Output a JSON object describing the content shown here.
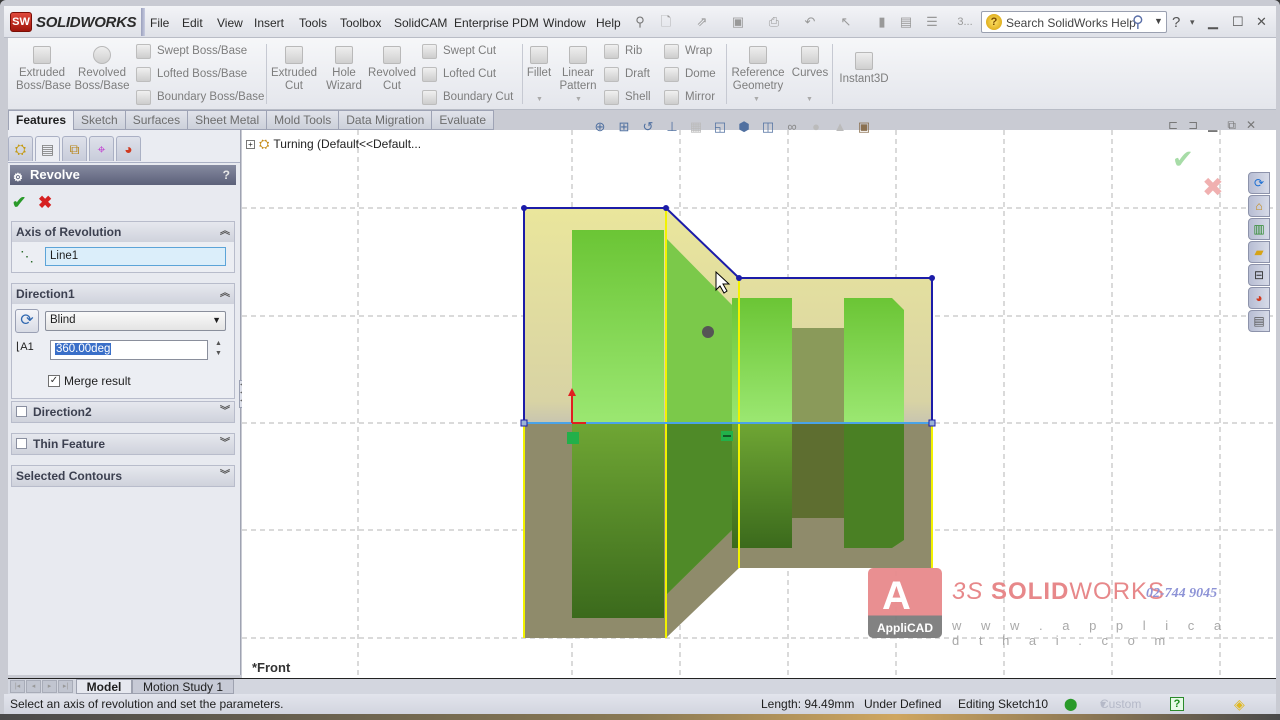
{
  "app": {
    "logo_text": "SOLIDWORKS",
    "logo_badge": "SW"
  },
  "menu": [
    "File",
    "Edit",
    "View",
    "Insert",
    "Tools",
    "Toolbox",
    "SolidCAM",
    "Enterprise PDM",
    "Window",
    "Help"
  ],
  "quick_access_overflow": "3...",
  "search": {
    "placeholder": "Search SolidWorks Help"
  },
  "commandmanager": {
    "large_buttons": [
      {
        "label": "Extruded\nBoss/Base",
        "line1": "Extruded",
        "line2": "Boss/Base"
      },
      {
        "label": "Revolved Boss/Base",
        "line1": "Revolved",
        "line2": "Boss/Base"
      },
      {
        "label": "Extruded Cut",
        "line1": "Extruded",
        "line2": "Cut"
      },
      {
        "label": "Hole Wizard",
        "line1": "Hole",
        "line2": "Wizard"
      },
      {
        "label": "Revolved Cut",
        "line1": "Revolved",
        "line2": "Cut"
      },
      {
        "label": "Fillet",
        "line1": "Fillet",
        "line2": ""
      },
      {
        "label": "Linear Pattern",
        "line1": "Linear",
        "line2": "Pattern"
      },
      {
        "label": "Reference Geometry",
        "line1": "Reference",
        "line2": "Geometry"
      },
      {
        "label": "Curves",
        "line1": "Curves",
        "line2": ""
      },
      {
        "label": "Instant3D",
        "line1": "Instant3D",
        "line2": ""
      }
    ],
    "small_buttons": [
      "Swept Boss/Base",
      "Lofted Boss/Base",
      "Boundary Boss/Base",
      "Swept Cut",
      "Lofted Cut",
      "Boundary Cut",
      "Rib",
      "Draft",
      "Shell",
      "Wrap",
      "Dome",
      "Mirror"
    ]
  },
  "tabs": [
    {
      "label": "Features",
      "active": true
    },
    {
      "label": "Sketch"
    },
    {
      "label": "Surfaces"
    },
    {
      "label": "Sheet Metal"
    },
    {
      "label": "Mold Tools"
    },
    {
      "label": "Data Migration"
    },
    {
      "label": "Evaluate"
    }
  ],
  "panel_tabs": [
    "feature-manager-icon",
    "property-manager-icon",
    "configuration-manager-icon",
    "dimxpert-icon",
    "display-manager-icon"
  ],
  "property_manager": {
    "title": "Revolve",
    "help": "?",
    "ok": "✔",
    "cancel": "✖",
    "axis_group": {
      "title": "Axis of Revolution",
      "value": "Line1"
    },
    "direction1": {
      "title": "Direction1",
      "end_condition": "Blind",
      "angle": "360.00deg",
      "merge_result_label": "Merge result",
      "merge_result_checked": true
    },
    "direction2": {
      "title": "Direction2",
      "checked": false
    },
    "thin_feature": {
      "title": "Thin Feature",
      "checked": false
    },
    "selected_contours": {
      "title": "Selected Contours"
    }
  },
  "viewport": {
    "tree_item": "Turning  (Default<<Default...",
    "view_name": "*Front",
    "watermark": {
      "logo": "AppliCAD",
      "brand_thin": "SOLID",
      "brand_rest": "WORKS",
      "brand_prefix": "3S",
      "phone": "02-744 9045",
      "url": "w w w . a p p l i c a d t h a i . c o m"
    },
    "confirm_ok": "✔",
    "confirm_cancel": "✖"
  },
  "model_tabs": [
    {
      "label": "Model",
      "active": true
    },
    {
      "label": "Motion Study 1"
    }
  ],
  "status": {
    "message": "Select an axis of revolution and set the parameters.",
    "length": "Length: 94.49mm",
    "definition": "Under Defined",
    "editing": "Editing Sketch10",
    "units": "Custom",
    "units_arrow": "▾"
  },
  "colors": {
    "accent": "#1a1aa0",
    "sketch_line": "#1c1ca8",
    "axis": "#4aa3e8",
    "body_green": "#7ccc3a",
    "preview_yellow": "#e6e39a"
  }
}
